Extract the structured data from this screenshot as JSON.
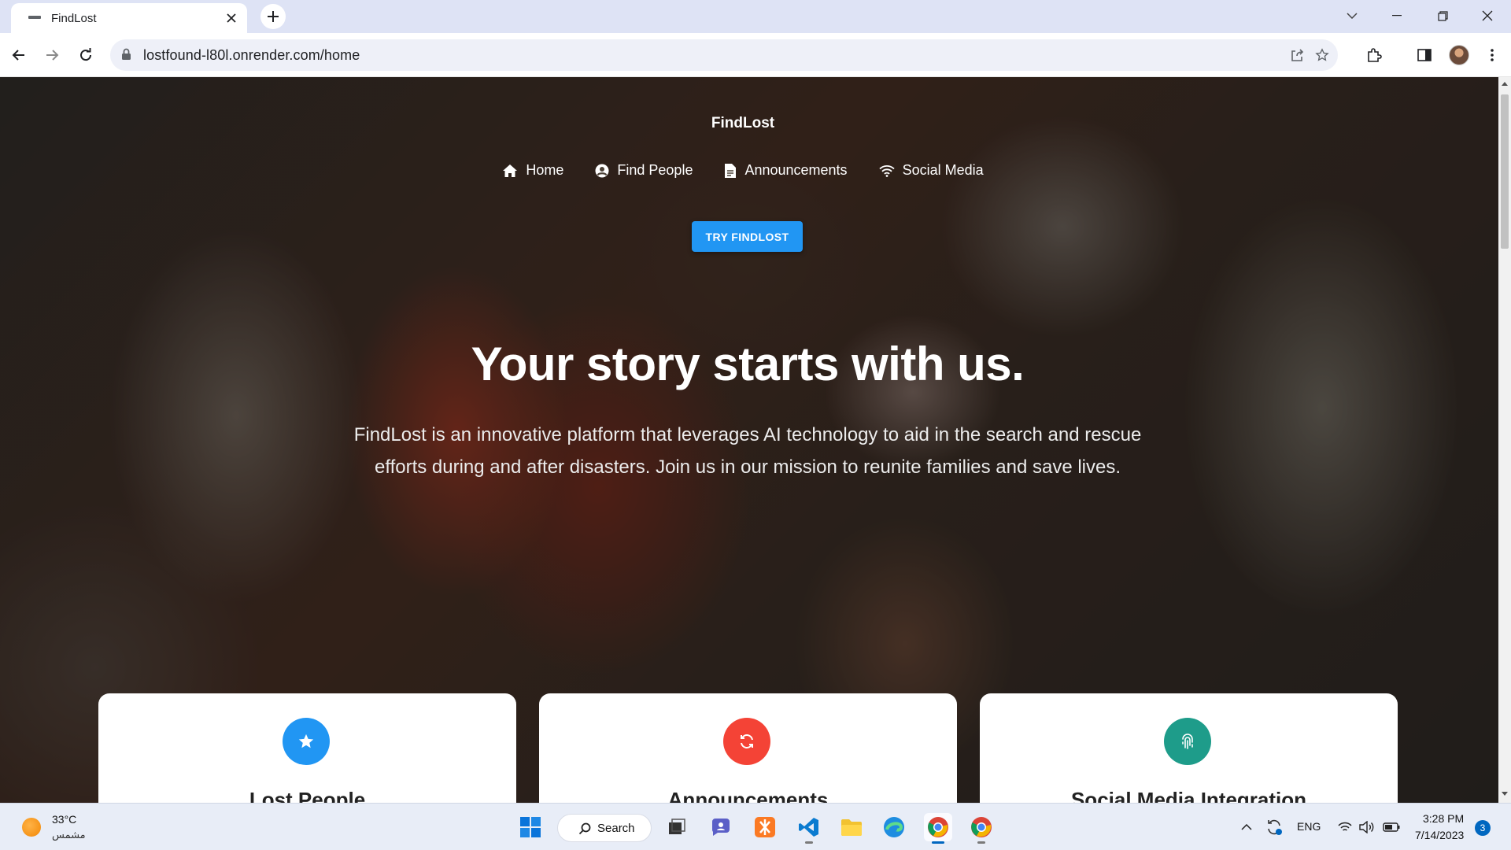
{
  "browser": {
    "tab_title": "FindLost",
    "url": "lostfound-l80l.onrender.com/home"
  },
  "site": {
    "brand": "FindLost",
    "nav": [
      {
        "label": "Home",
        "icon": "home-icon"
      },
      {
        "label": "Find People",
        "icon": "user-circle-icon"
      },
      {
        "label": "Announcements",
        "icon": "document-icon"
      },
      {
        "label": "Social Media",
        "icon": "wifi-icon"
      }
    ],
    "cta_label": "TRY FINDLOST",
    "headline": "Your story starts with us.",
    "subtext": "FindLost is an innovative platform that leverages AI technology to aid in the search and rescue efforts during and after disasters. Join us in our mission to reunite families and save lives.",
    "cards": [
      {
        "title": "Lost People",
        "icon": "star-icon",
        "color": "#2196f3"
      },
      {
        "title": "Announcements",
        "icon": "refresh-icon",
        "color": "#f44336"
      },
      {
        "title": "Social Media Integration",
        "icon": "fingerprint-icon",
        "color": "#1e9c8a"
      }
    ]
  },
  "taskbar": {
    "weather_temp": "33°C",
    "weather_desc": "مشمس",
    "search_label": "Search",
    "language": "ENG",
    "time": "3:28 PM",
    "date": "7/14/2023",
    "notifications": "3"
  },
  "colors": {
    "accent": "#2196f3",
    "card_red": "#f44336",
    "card_teal": "#1e9c8a"
  }
}
